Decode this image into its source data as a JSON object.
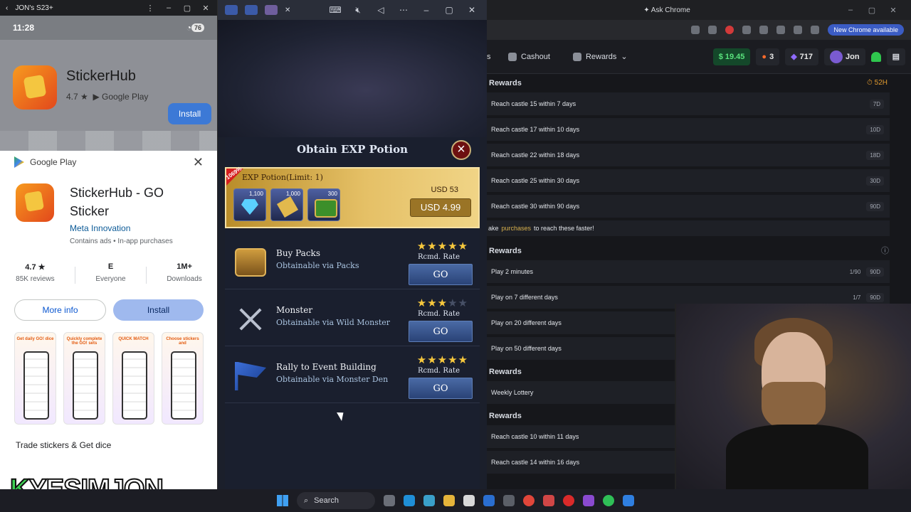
{
  "phone": {
    "window_title": "JON's S23+",
    "time": "11:28",
    "battery": "76",
    "banner": {
      "app_name": "StickerHub",
      "rating": "4.7 ★",
      "store": "Google Play",
      "install_label": "Install"
    },
    "sheet": {
      "header": "Google Play",
      "app_name": "StickerHub - GO Sticker",
      "developer": "Meta Innovation",
      "meta": "Contains ads  •  In-app purchases",
      "stats": [
        {
          "value": "4.7 ★",
          "label": "85K reviews"
        },
        {
          "value": "E",
          "label": "Everyone"
        },
        {
          "value": "1M+",
          "label": "Downloads"
        }
      ],
      "more_info_label": "More info",
      "install_label": "Install",
      "screenshots": [
        "Get daily GO! dice",
        "Quickly complete the GO! sets",
        "QUICK MATCH",
        "Choose stickers and"
      ],
      "tagline": "Trade stickers & Get dice"
    }
  },
  "brand": {
    "prefix": "K",
    "text": "YESIMJON"
  },
  "game": {
    "popup_title": "Obtain EXP Potion",
    "offer": {
      "badge": "1069%",
      "title": "EXP Potion(Limit: 1)",
      "items": [
        {
          "icon": "gem-icon",
          "qty": "1,100"
        },
        {
          "icon": "scroll-icon",
          "qty": "1,000"
        },
        {
          "icon": "chest-icon",
          "qty": "300"
        }
      ],
      "old_price": "USD 53",
      "price": "USD 4.99"
    },
    "sources": [
      {
        "name": "Buy Packs",
        "sub": "Obtainable via Packs",
        "stars": 5,
        "rate_label": "Rcmd. Rate",
        "go": "GO"
      },
      {
        "name": "Monster",
        "sub": "Obtainable via Wild Monster",
        "stars": 3,
        "rate_label": "Rcmd. Rate",
        "go": "GO"
      },
      {
        "name": "Rally to Event Building",
        "sub": "Obtainable via Monster Den",
        "stars": 5,
        "rate_label": "Rcmd. Rate",
        "go": "GO"
      }
    ]
  },
  "browser": {
    "ask_chrome": "Ask Chrome",
    "new_chrome": "New Chrome available",
    "nav": {
      "cashout": "Cashout",
      "rewards": "Rewards"
    },
    "balance": "$ 19.45",
    "fire": "3",
    "gems": "717",
    "user": "Jon",
    "sections": [
      {
        "title": "Rewards",
        "timer": "52H",
        "tasks": [
          {
            "label": "Reach castle 15 within 7 days",
            "badge": "7D"
          },
          {
            "label": "Reach castle 17 within 10 days",
            "badge": "10D"
          },
          {
            "label": "Reach castle 22 within 18 days",
            "badge": "18D"
          },
          {
            "label": "Reach castle 25 within 30 days",
            "badge": "30D"
          },
          {
            "label": "Reach castle 30 within 90 days",
            "badge": "90D"
          }
        ],
        "hint": {
          "before": "ake",
          "link": "purchases",
          "after": "to reach these faster!"
        }
      },
      {
        "title": "Rewards",
        "tasks": [
          {
            "label": "Play 2 minutes",
            "progress": "1/90",
            "badge": "90D"
          },
          {
            "label": "Play on 7 different days",
            "progress": "1/7",
            "badge": "90D"
          },
          {
            "label": "Play on 20 different days"
          },
          {
            "label": "Play on 50 different days"
          }
        ]
      },
      {
        "title": "Rewards",
        "tasks": [
          {
            "label": "Weekly Lottery"
          }
        ]
      },
      {
        "title": "Rewards",
        "tasks": [
          {
            "label": "Reach castle 10 within 11 days"
          },
          {
            "label": "Reach castle 14 within 16 days"
          }
        ]
      }
    ]
  },
  "taskbar": {
    "search": "Search"
  }
}
